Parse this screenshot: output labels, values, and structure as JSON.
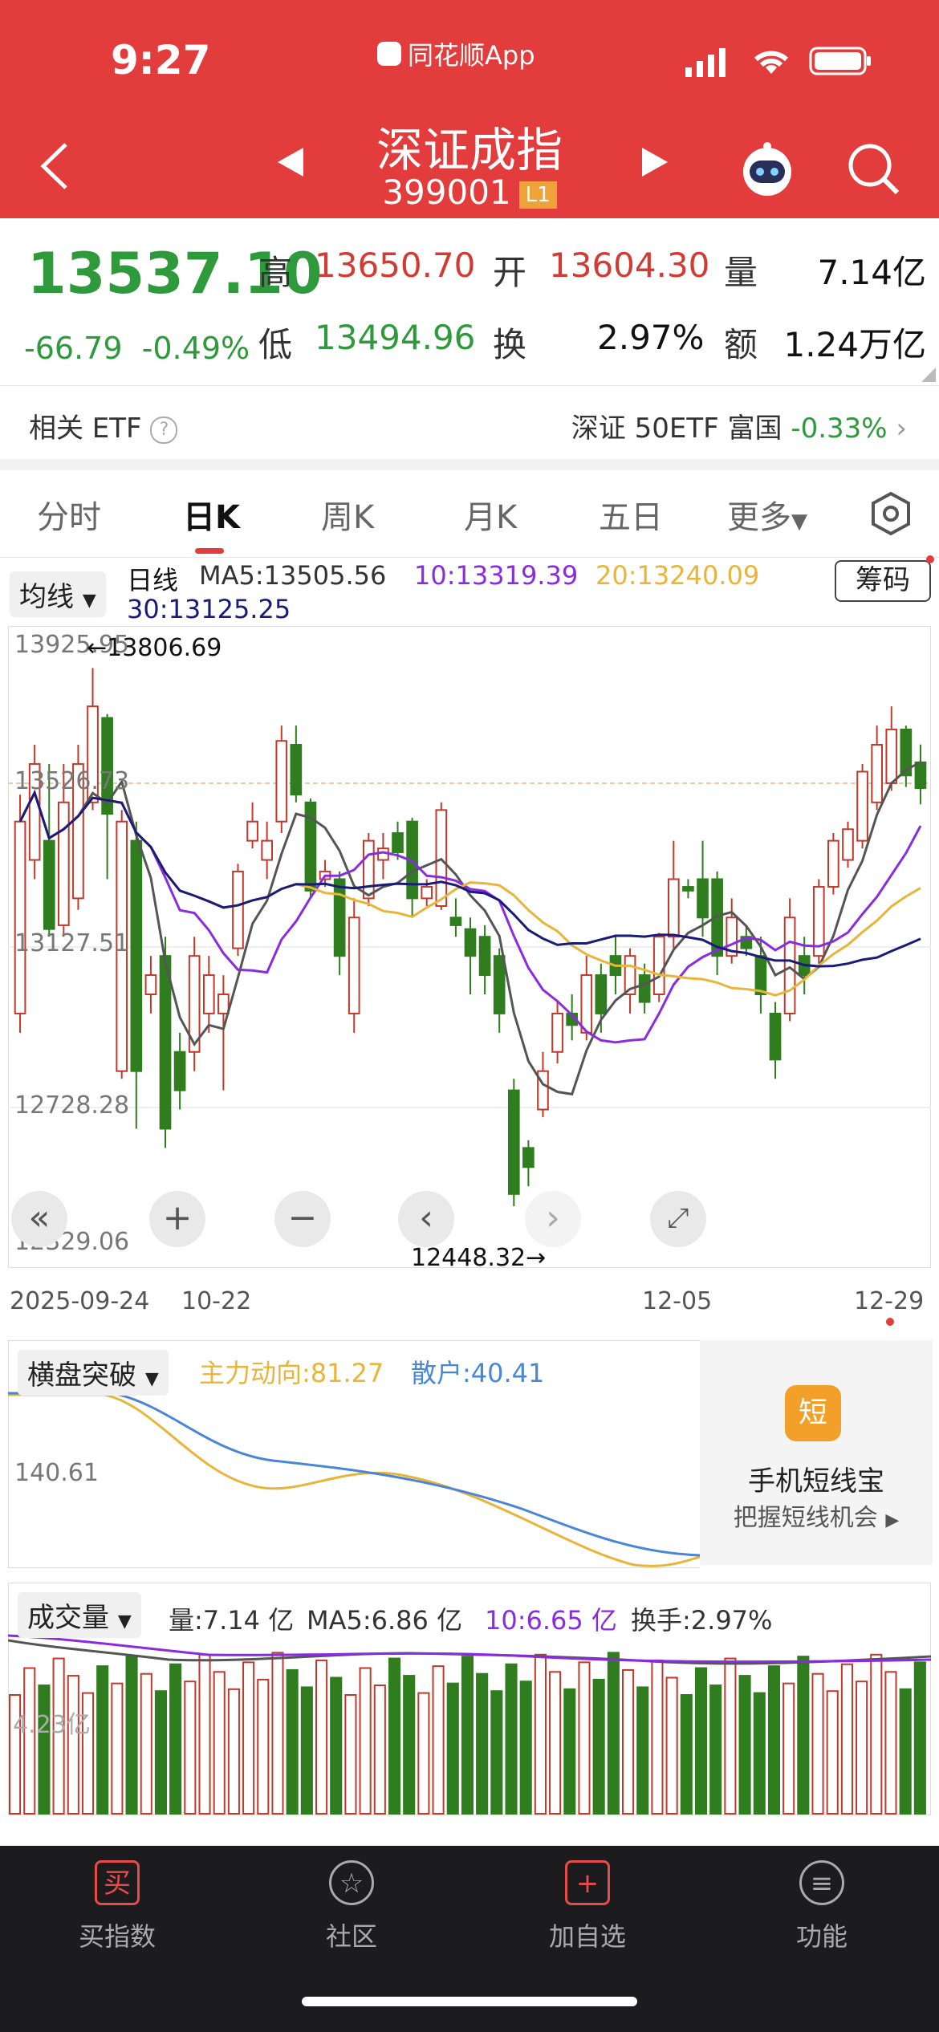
{
  "status_bar": {
    "time": "9:27",
    "app_name": "同花顺App"
  },
  "header": {
    "title": "深证成指",
    "code": "399001",
    "badge": "L1"
  },
  "quote": {
    "price": "13537.10",
    "change": "-66.79",
    "change_pct": "-0.49%",
    "high_label": "高",
    "high": "13650.70",
    "open_label": "开",
    "open": "13604.30",
    "volume_label": "量",
    "volume": "7.14亿",
    "low_label": "低",
    "low": "13494.96",
    "turnover_label": "换",
    "turnover": "2.97%",
    "amount_label": "额",
    "amount": "1.24万亿"
  },
  "etf": {
    "label": "相关 ETF",
    "name": "深证 50ETF 富国",
    "change": "-0.33%"
  },
  "tabs": [
    "分时",
    "日K",
    "周K",
    "月K",
    "五日",
    "更多"
  ],
  "active_tab": "日K",
  "ma_panel": {
    "indicator_btn": "均线",
    "period": "日线",
    "ma5": "MA5:13505.56",
    "ma10": "10:13319.39",
    "ma20": "20:13240.09",
    "ma30": "30:13125.25",
    "chip_btn": "筹码"
  },
  "kline": {
    "y_labels": [
      "13925.95",
      "13526.73",
      "13127.51",
      "12728.28",
      "12329.06"
    ],
    "max_label": "←13806.69",
    "min_label": "12448.32→",
    "dates": [
      "2025-09-24",
      "10-22",
      "12-05",
      "12-29"
    ]
  },
  "flow_panel": {
    "indicator_btn": "横盘突破",
    "main_force": "主力动向:81.27",
    "retail": "散户:40.41",
    "y_label": "140.61",
    "promo_title": "手机短线宝",
    "promo_sub": "把握短线机会",
    "promo_icon": "短"
  },
  "volume_panel": {
    "indicator_btn": "成交量",
    "vol": "量:7.14 亿",
    "ma5": "MA5:6.86 亿",
    "ma10": "10:6.65 亿",
    "turnover": "换手:2.97%",
    "y_label": "4.23亿"
  },
  "bottom_nav": [
    {
      "label": "买指数",
      "icon": "买"
    },
    {
      "label": "社区",
      "icon": "☆"
    },
    {
      "label": "加自选",
      "icon": "+"
    },
    {
      "label": "功能",
      "icon": "≡"
    }
  ],
  "colors": {
    "header": "#e23d3c",
    "up": "#c0392b",
    "down": "#2f7d1f",
    "ma5": "#555555",
    "ma10": "#8a2be2",
    "ma20": "#e8b53a",
    "ma30": "#1a1a7a"
  },
  "chart_data": {
    "type": "candlestick",
    "y_axis_labels": [
      13925.95,
      13526.73,
      13127.51,
      12728.28,
      12329.06
    ],
    "candles": [
      {
        "o": 12950,
        "c": 13450,
        "h": 13520,
        "l": 12900,
        "up": true
      },
      {
        "o": 13350,
        "c": 13600,
        "h": 13650,
        "l": 13300,
        "up": true
      },
      {
        "o": 13400,
        "c": 13170,
        "h": 13600,
        "l": 13150,
        "up": false
      },
      {
        "o": 13180,
        "c": 13500,
        "h": 13600,
        "l": 13150,
        "up": true
      },
      {
        "o": 13250,
        "c": 13600,
        "h": 13650,
        "l": 13220,
        "up": true
      },
      {
        "o": 13500,
        "c": 13750,
        "h": 13850,
        "l": 13480,
        "up": true
      },
      {
        "o": 13720,
        "c": 13470,
        "h": 13730,
        "l": 13300,
        "up": false
      },
      {
        "o": 12800,
        "c": 13450,
        "h": 13480,
        "l": 12780,
        "up": true
      },
      {
        "o": 13400,
        "c": 12800,
        "h": 13450,
        "l": 12650,
        "up": false
      },
      {
        "o": 13000,
        "c": 13050,
        "h": 13100,
        "l": 12950,
        "up": true
      },
      {
        "o": 13100,
        "c": 12650,
        "h": 13150,
        "l": 12600,
        "up": false
      },
      {
        "o": 12850,
        "c": 12750,
        "h": 12900,
        "l": 12700,
        "up": false
      },
      {
        "o": 12850,
        "c": 13100,
        "h": 13150,
        "l": 12800,
        "up": true
      },
      {
        "o": 12950,
        "c": 13050,
        "h": 13100,
        "l": 12900,
        "up": true
      },
      {
        "o": 12950,
        "c": 13000,
        "h": 13050,
        "l": 12750,
        "up": true
      },
      {
        "o": 13120,
        "c": 13320,
        "h": 13340,
        "l": 13100,
        "up": true
      },
      {
        "o": 13400,
        "c": 13450,
        "h": 13500,
        "l": 13380,
        "up": true
      },
      {
        "o": 13350,
        "c": 13400,
        "h": 13450,
        "l": 13300,
        "up": true
      },
      {
        "o": 13450,
        "c": 13660,
        "h": 13700,
        "l": 13420,
        "up": true
      },
      {
        "o": 13650,
        "c": 13520,
        "h": 13700,
        "l": 13500,
        "up": false
      },
      {
        "o": 13500,
        "c": 13270,
        "h": 13510,
        "l": 13250,
        "up": false
      },
      {
        "o": 13300,
        "c": 13320,
        "h": 13350,
        "l": 13280,
        "up": true
      },
      {
        "o": 13300,
        "c": 13100,
        "h": 13320,
        "l": 13050,
        "up": false
      },
      {
        "o": 12950,
        "c": 13200,
        "h": 13250,
        "l": 12900,
        "up": true
      },
      {
        "o": 13250,
        "c": 13400,
        "h": 13420,
        "l": 13230,
        "up": true
      },
      {
        "o": 13350,
        "c": 13380,
        "h": 13420,
        "l": 13300,
        "up": true
      },
      {
        "o": 13420,
        "c": 13370,
        "h": 13450,
        "l": 13350,
        "up": false
      },
      {
        "o": 13450,
        "c": 13250,
        "h": 13460,
        "l": 13200,
        "up": false
      },
      {
        "o": 13250,
        "c": 13280,
        "h": 13300,
        "l": 13230,
        "up": true
      },
      {
        "o": 13230,
        "c": 13480,
        "h": 13500,
        "l": 13220,
        "up": true
      },
      {
        "o": 13200,
        "c": 13180,
        "h": 13250,
        "l": 13150,
        "up": false
      },
      {
        "o": 13170,
        "c": 13100,
        "h": 13200,
        "l": 13000,
        "up": false
      },
      {
        "o": 13150,
        "c": 13050,
        "h": 13180,
        "l": 13000,
        "up": false
      },
      {
        "o": 13100,
        "c": 12950,
        "h": 13120,
        "l": 12900,
        "up": false
      },
      {
        "o": 12750,
        "c": 12480,
        "h": 12780,
        "l": 12448.32,
        "up": false
      },
      {
        "o": 12600,
        "c": 12550,
        "h": 12620,
        "l": 12500,
        "up": false
      },
      {
        "o": 12700,
        "c": 12800,
        "h": 12850,
        "l": 12680,
        "up": true
      },
      {
        "o": 12850,
        "c": 12950,
        "h": 12980,
        "l": 12820,
        "up": true
      },
      {
        "o": 12950,
        "c": 12920,
        "h": 13000,
        "l": 12880,
        "up": false
      },
      {
        "o": 12900,
        "c": 13050,
        "h": 13100,
        "l": 12880,
        "up": true
      },
      {
        "o": 13050,
        "c": 12950,
        "h": 13080,
        "l": 12900,
        "up": false
      },
      {
        "o": 13100,
        "c": 13050,
        "h": 13150,
        "l": 13000,
        "up": false
      },
      {
        "o": 13000,
        "c": 13100,
        "h": 13120,
        "l": 12950,
        "up": true
      },
      {
        "o": 13050,
        "c": 12980,
        "h": 13080,
        "l": 12950,
        "up": false
      },
      {
        "o": 13000,
        "c": 13150,
        "h": 13160,
        "l": 12980,
        "up": true
      },
      {
        "o": 13150,
        "c": 13300,
        "h": 13400,
        "l": 13120,
        "up": true
      },
      {
        "o": 13280,
        "c": 13270,
        "h": 13300,
        "l": 13250,
        "up": false
      },
      {
        "o": 13300,
        "c": 13200,
        "h": 13400,
        "l": 13150,
        "up": false
      },
      {
        "o": 13300,
        "c": 13100,
        "h": 13320,
        "l": 13050,
        "up": false
      },
      {
        "o": 13100,
        "c": 13200,
        "h": 13250,
        "l": 13080,
        "up": true
      },
      {
        "o": 13150,
        "c": 13120,
        "h": 13180,
        "l": 13100,
        "up": false
      },
      {
        "o": 13100,
        "c": 13000,
        "h": 13150,
        "l": 12950,
        "up": false
      },
      {
        "o": 12950,
        "c": 12830,
        "h": 12980,
        "l": 12780,
        "up": false
      },
      {
        "o": 12950,
        "c": 13200,
        "h": 13250,
        "l": 12930,
        "up": true
      },
      {
        "o": 13100,
        "c": 13050,
        "h": 13150,
        "l": 13000,
        "up": false
      },
      {
        "o": 13100,
        "c": 13280,
        "h": 13300,
        "l": 13080,
        "up": true
      },
      {
        "o": 13280,
        "c": 13400,
        "h": 13420,
        "l": 13260,
        "up": true
      },
      {
        "o": 13350,
        "c": 13430,
        "h": 13450,
        "l": 13330,
        "up": true
      },
      {
        "o": 13400,
        "c": 13580,
        "h": 13600,
        "l": 13380,
        "up": true
      },
      {
        "o": 13500,
        "c": 13650,
        "h": 13700,
        "l": 13480,
        "up": true
      },
      {
        "o": 13550,
        "c": 13690,
        "h": 13750,
        "l": 13530,
        "up": true
      },
      {
        "o": 13690,
        "c": 13570,
        "h": 13700,
        "l": 13540,
        "up": false
      },
      {
        "o": 13604.3,
        "c": 13537.1,
        "h": 13650.7,
        "l": 13494.96,
        "up": false
      }
    ]
  }
}
